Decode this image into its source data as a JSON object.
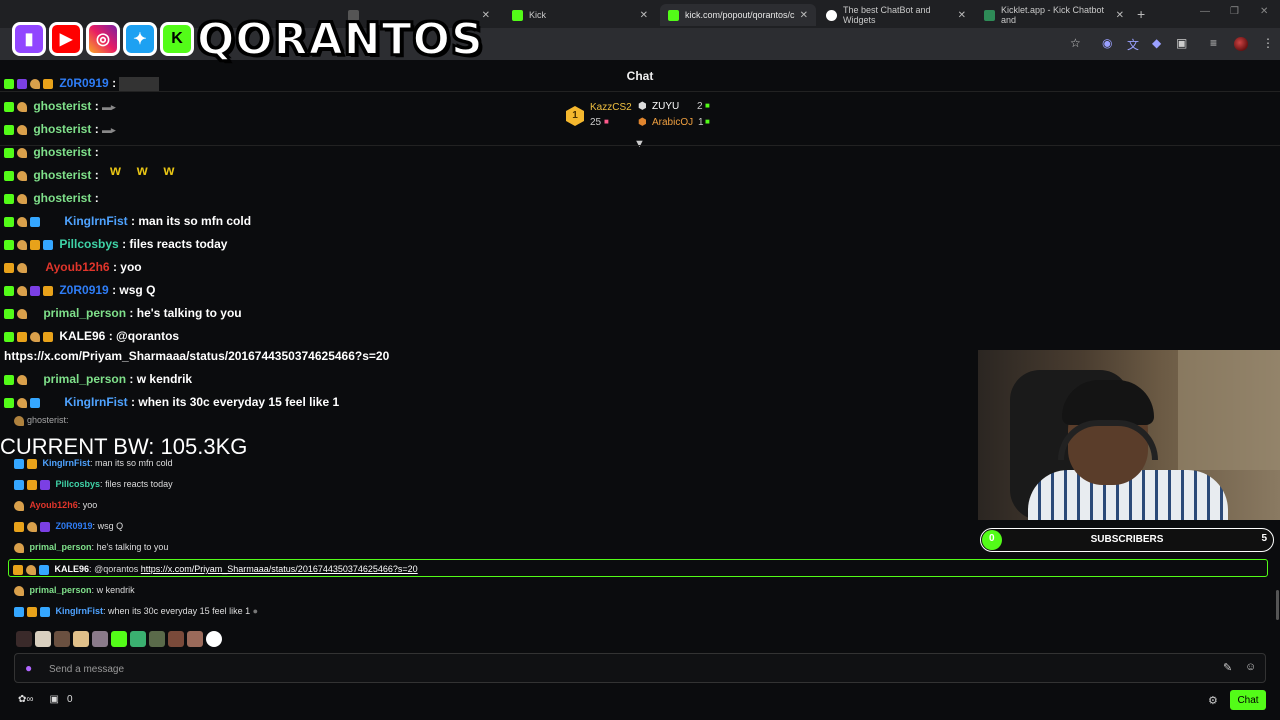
{
  "browser": {
    "tabs": [
      {
        "label": "",
        "favicon_color": "#555555"
      },
      {
        "label": "Kick",
        "favicon_color": "#53fc18"
      },
      {
        "label": "kick.com/popout/qorantos/cha",
        "favicon_color": "#53fc18"
      },
      {
        "label": "The best ChatBot and Widgets",
        "favicon_color": "#ffffff"
      },
      {
        "label": "Kicklet.app - Kick Chatbot and",
        "favicon_color": "#2e8b57"
      }
    ],
    "new_tab": "+"
  },
  "overlay": {
    "logo_text": "QORANTOS",
    "social_icons": [
      "twitch-icon",
      "youtube-icon",
      "instagram-icon",
      "twitter-icon",
      "kick-icon"
    ],
    "chat_lines": [
      {
        "user": "Z0R0919",
        "sep": ":",
        "msg": "",
        "color": "#2f7df6"
      },
      {
        "user": "ghosterist",
        "sep": ":",
        "msg": "",
        "color": "#7fe08a"
      },
      {
        "user": "ghosterist",
        "sep": ":",
        "msg": "",
        "color": "#7fe08a"
      },
      {
        "user": "ghosterist",
        "sep": ":",
        "msg": "",
        "color": "#7fe08a"
      },
      {
        "user": "ghosterist",
        "sep": ":",
        "msg": "",
        "color": "#7fe08a"
      },
      {
        "user": "ghosterist",
        "sep": ":",
        "msg": "",
        "color": "#7fe08a"
      },
      {
        "user": "KingIrnFist",
        "sep": ":",
        "msg": "man its so mfn cold",
        "color": "#4fa3ff"
      },
      {
        "user": "Pillcosbys",
        "sep": ":",
        "msg": "files reacts today",
        "color": "#3fd3a7"
      },
      {
        "user": "Ayoub12h6",
        "sep": ":",
        "msg": "yoo",
        "color": "#e0352b"
      },
      {
        "user": "Z0R0919",
        "sep": ":",
        "msg": "wsg Q",
        "color": "#2f7df6"
      },
      {
        "user": "primal_person",
        "sep": ":",
        "msg": "he's talking to you",
        "color": "#7fe08a"
      },
      {
        "user": "KALE96",
        "sep": ":",
        "msg": "@qorantos",
        "color": "#ffffff"
      },
      {
        "user": "primal_person",
        "sep": ":",
        "msg": "w kendrik",
        "color": "#7fe08a"
      },
      {
        "user": "KingIrnFist",
        "sep": ":",
        "msg": "when its 30c everyday 15 feel like 1",
        "color": "#4fa3ff"
      }
    ],
    "coin_row": "w w w",
    "link": "https://x.com/Priyam_Sharmaaa/status/2016744350374625466?s=20",
    "bw_label": "CURRENT BW: 105.3KG"
  },
  "chat": {
    "title": "Chat",
    "leaderboard": {
      "rank": "1",
      "first": {
        "user": "KazzCS2",
        "count": "25"
      },
      "second": {
        "user": "ZUYU",
        "count": "2"
      },
      "third": {
        "user": "ArabicOJ",
        "count": "1"
      }
    },
    "messages": [
      {
        "user": "KingIrnFist",
        "sep": ":",
        "text": "man its so mfn cold",
        "color": "#4fa3ff"
      },
      {
        "user": "Pillcosbys",
        "sep": ":",
        "text": "files reacts today",
        "color": "#3fd3a7"
      },
      {
        "user": "Ayoub12h6",
        "sep": ":",
        "text": "yoo",
        "color": "#e0352b"
      },
      {
        "user": "Z0R0919",
        "sep": ":",
        "text": "wsg Q",
        "color": "#2f7df6"
      },
      {
        "user": "primal_person",
        "sep": ":",
        "text": "he's talking to you",
        "color": "#7fe08a"
      },
      {
        "user": "KALE96",
        "sep": ":",
        "text": "@qorantos",
        "link": "https://x.com/Priyam_Sharmaaa/status/2016744350374625466?s=20",
        "color": "#ffffff"
      },
      {
        "user": "primal_person",
        "sep": ":",
        "text": "w kendrik",
        "color": "#7fe08a"
      },
      {
        "user": "KingIrnFist",
        "sep": ":",
        "text": "when its 30c everyday 15 feel like 1",
        "color": "#4fa3ff"
      }
    ],
    "input": {
      "placeholder": "Send a message",
      "value": ""
    },
    "footer": {
      "count": "0",
      "button": "Chat"
    }
  },
  "subscribers": {
    "current": "0",
    "label": "SUBSCRIBERS",
    "goal": "5",
    "progress": 0
  },
  "colors": {
    "kick_green": "#53fc18",
    "background": "#0b0c0e"
  }
}
